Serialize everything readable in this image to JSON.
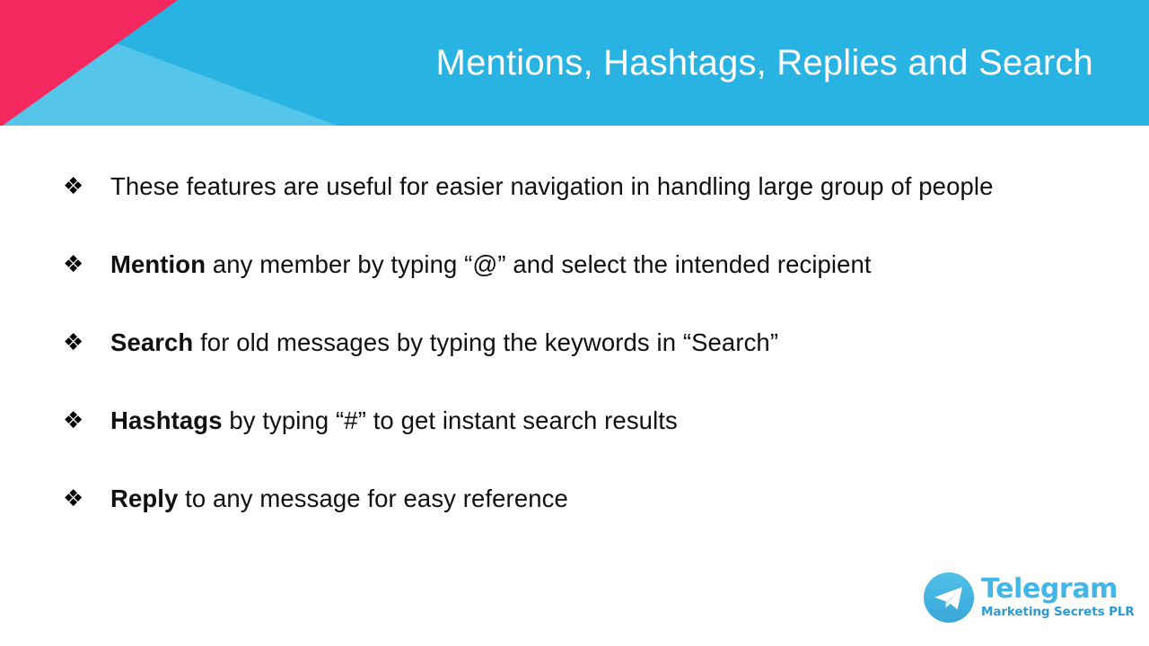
{
  "slide": {
    "title": "Mentions, Hashtags, Replies and Search",
    "bullet_marker": "❖",
    "bullets": [
      {
        "lead": "",
        "text": "These features are useful for easier navigation in handling large group of people"
      },
      {
        "lead": "Mention",
        "text": " any member by typing “@” and select the intended recipient"
      },
      {
        "lead": "Search",
        "text": " for old messages by typing the keywords in “Search”"
      },
      {
        "lead": "Hashtags",
        "text": " by typing “#” to get instant search results"
      },
      {
        "lead": "Reply",
        "text": " to any message for easy reference"
      }
    ]
  },
  "logo": {
    "name": "Telegram",
    "tagline": "Marketing Secrets PLR",
    "icon": "paper-plane-icon"
  },
  "colors": {
    "header_blue": "#29b3e3",
    "header_light_blue": "#55c5ea",
    "header_pink": "#f5275f",
    "title_text": "#ffffff",
    "body_text": "#101010",
    "logo_name": "#43b6e8",
    "logo_tagline": "#2c9ad1",
    "background": "#ffffff"
  }
}
